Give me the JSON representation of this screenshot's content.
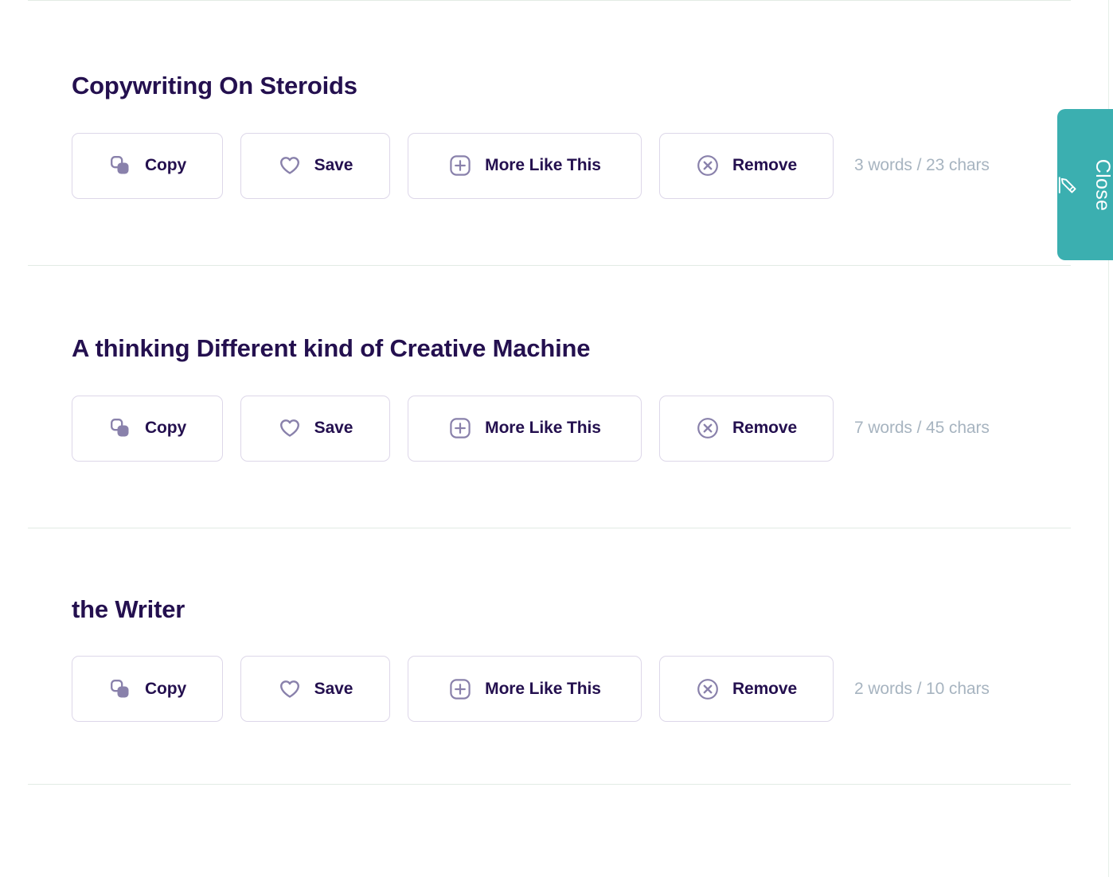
{
  "panel": {
    "close_tab": {
      "label": "Close",
      "icon": "pencil-edit-icon",
      "color": "#3bafb0"
    },
    "divider_color": "#e2ebe4",
    "title_color": "#24104f",
    "meta_color": "#a7b4c0",
    "button_border_color": "#ddd7e9"
  },
  "actions": {
    "copy": {
      "label": "Copy",
      "icon": "copy-icon"
    },
    "save": {
      "label": "Save",
      "icon": "heart-icon"
    },
    "more_like_this": {
      "label": "More Like This",
      "icon": "plus-square-icon"
    },
    "remove": {
      "label": "Remove",
      "icon": "circle-x-icon"
    }
  },
  "results": [
    {
      "title": "Copywriting On Steroids",
      "meta": "3 words / 23 chars"
    },
    {
      "title": "A thinking Different kind of Creative Machine",
      "meta": "7 words / 45 chars"
    },
    {
      "title": "the Writer",
      "meta": "2 words / 10 chars"
    }
  ]
}
